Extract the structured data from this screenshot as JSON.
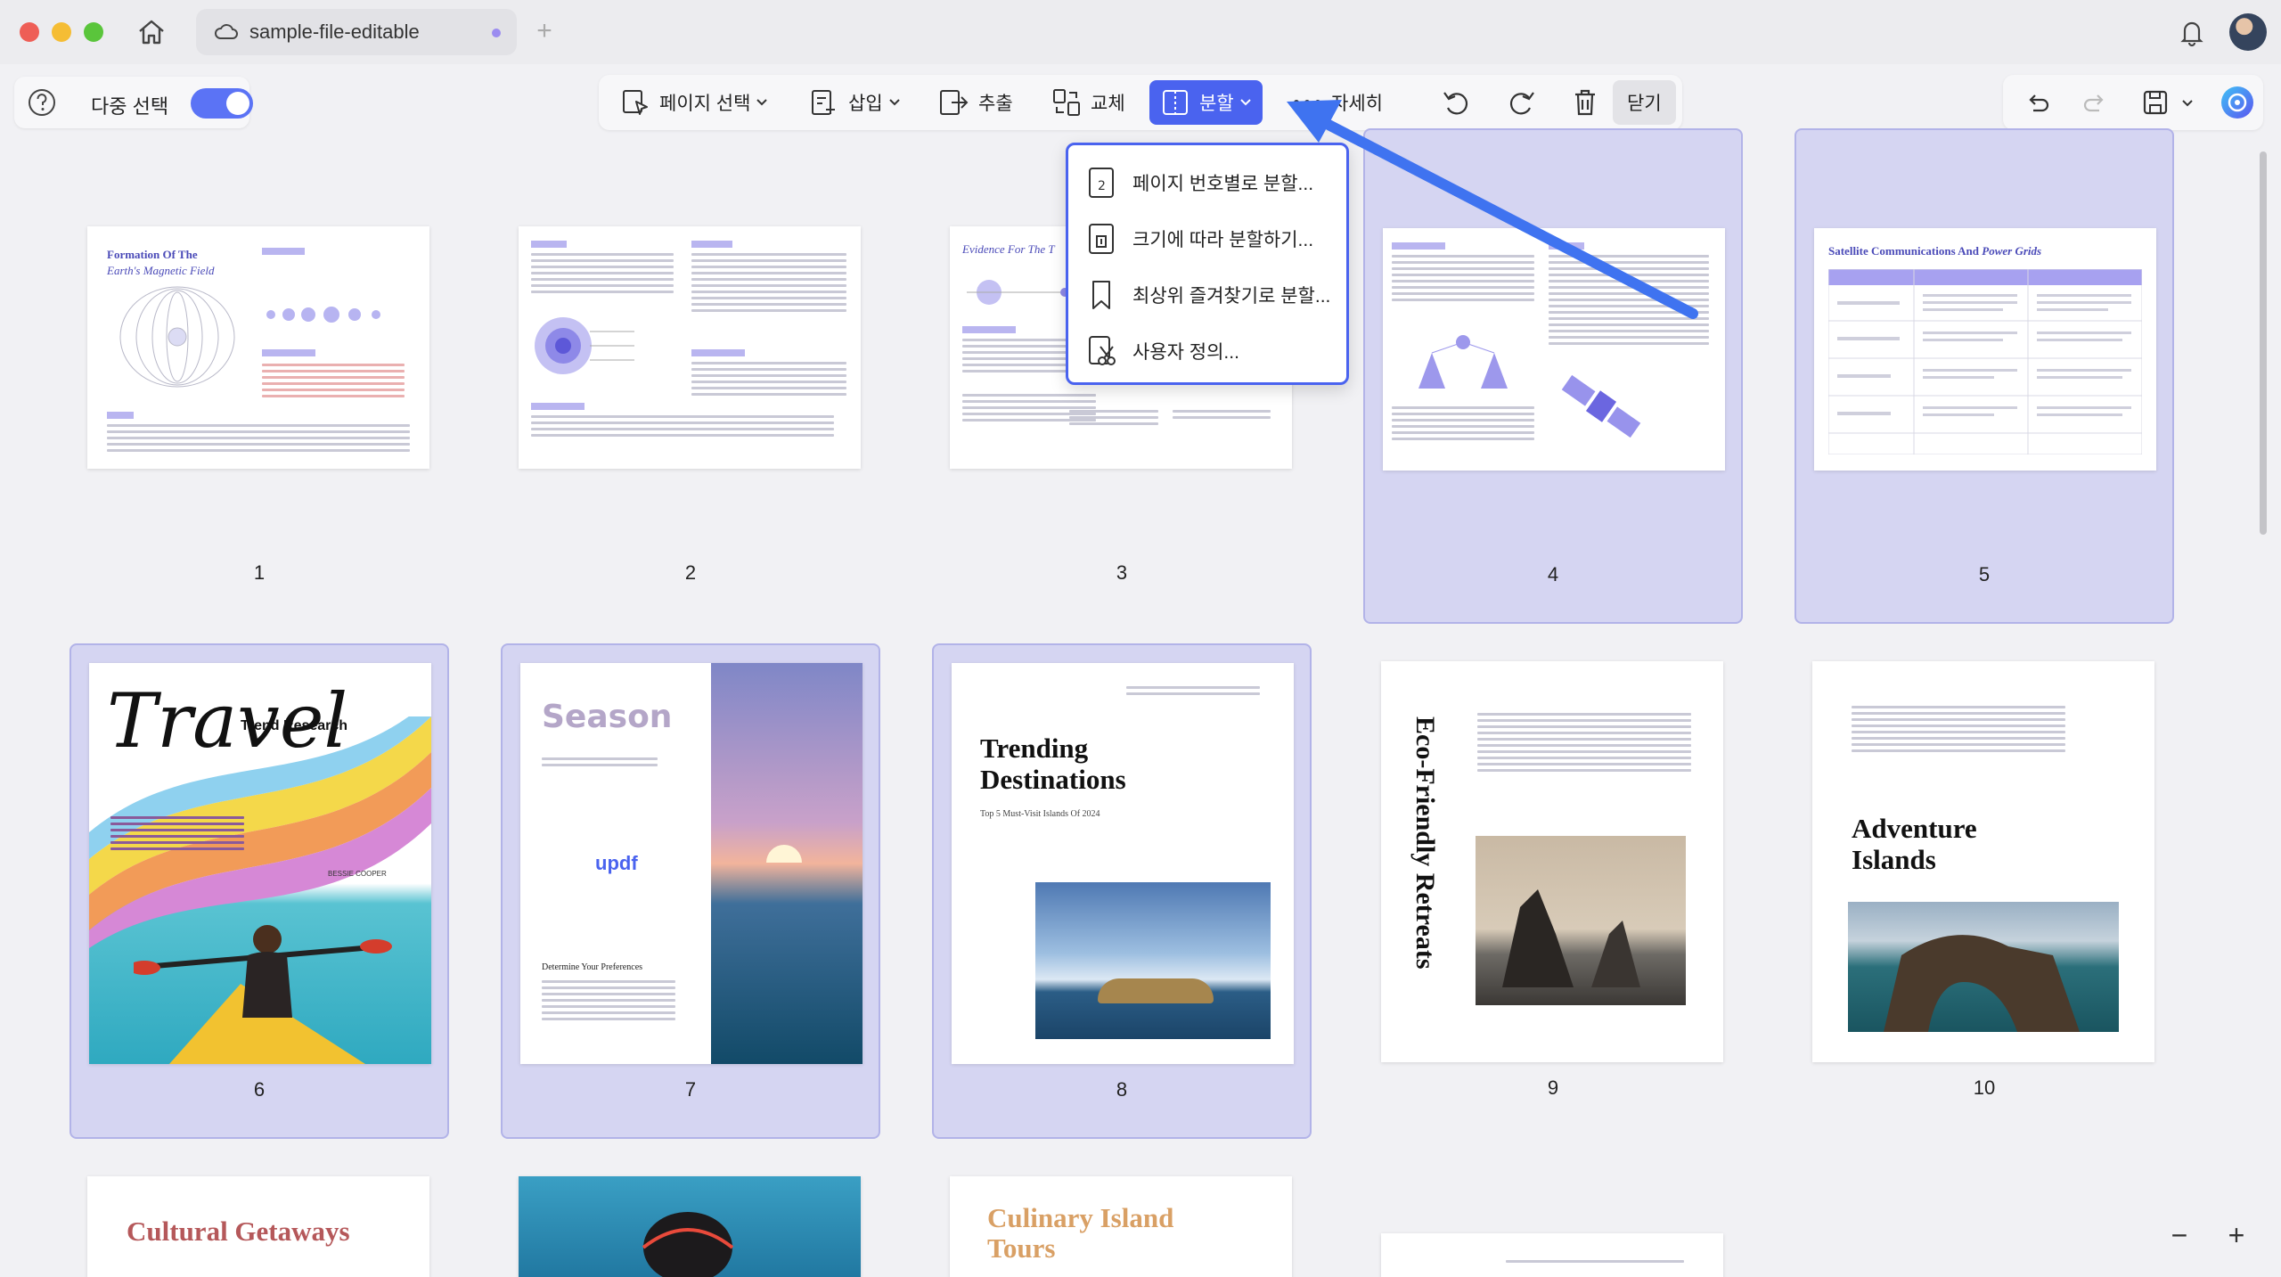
{
  "window": {
    "tab_title": "sample-file-editable",
    "new_tab_symbol": "+"
  },
  "left_panel": {
    "multi_select_label": "다중 선택",
    "multi_select_on": true
  },
  "toolbar": {
    "page_select": "페이지 선택",
    "insert": "삽입",
    "extract": "추출",
    "replace": "교체",
    "split": "분할",
    "detail": "자세히",
    "close": "닫기"
  },
  "split_menu": {
    "items": [
      "페이지 번호별로 분할...",
      "크기에 따라 분할하기...",
      "최상위 즐겨찾기로 분할...",
      "사용자 정의..."
    ]
  },
  "pages": [
    {
      "num": "1",
      "selected": false
    },
    {
      "num": "2",
      "selected": false
    },
    {
      "num": "3",
      "selected": false
    },
    {
      "num": "4",
      "selected": true
    },
    {
      "num": "5",
      "selected": true
    },
    {
      "num": "6",
      "selected": true
    },
    {
      "num": "7",
      "selected": true
    },
    {
      "num": "8",
      "selected": true
    },
    {
      "num": "9",
      "selected": false
    },
    {
      "num": "10",
      "selected": false
    }
  ],
  "thumbs": {
    "p1_title": "Formation Of The",
    "p1_subtitle": "Earth's Magnetic Field",
    "p3_title": "Evidence For The T",
    "p5_title": "Satellite Communications And",
    "p5_title_italic": "Power Grids",
    "p6_title": "Travel",
    "p6_sub": "Trend Research",
    "p6_author": "BESSIE COOPER",
    "p7_title": "Season",
    "p7_brand": "updf",
    "p7_heading": "Determine Your Preferences",
    "p8_title": "Trending Destinations",
    "p8_sub": "Top 5 Must-Visit Islands Of 2024",
    "p9_title": "Eco-Friendly Retreats",
    "p10_title": "Adventure Islands",
    "p11_title": "Cultural Getaways",
    "p13_title": "Culinary Island Tours"
  },
  "zoom": {
    "minus": "−",
    "plus": "+"
  },
  "colors": {
    "accent": "#4a63ef",
    "selection_bg": "#d5d5f2",
    "annotation_arrow": "#3f73f0"
  }
}
